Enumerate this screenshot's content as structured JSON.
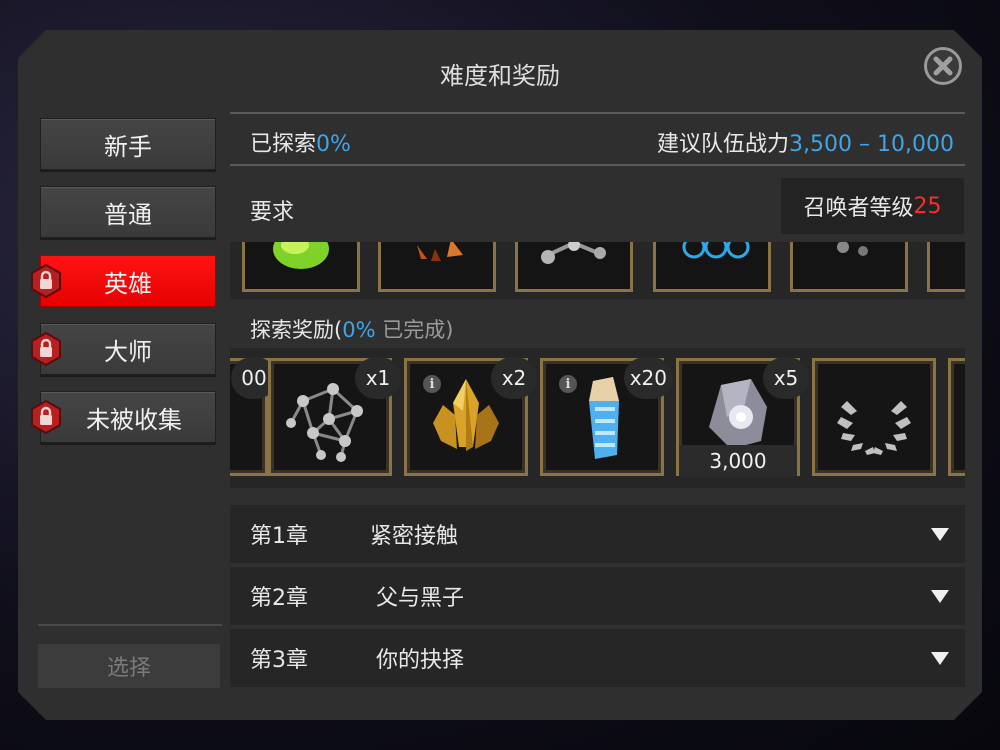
{
  "title": "难度和奖励",
  "difficulties": [
    {
      "label": "新手",
      "active": false,
      "locked": false
    },
    {
      "label": "普通",
      "active": false,
      "locked": false
    },
    {
      "label": "英雄",
      "active": true,
      "locked": true
    },
    {
      "label": "大师",
      "active": false,
      "locked": true
    },
    {
      "label": "未被收集",
      "active": false,
      "locked": true
    }
  ],
  "select_label": "选择",
  "explored": {
    "label": "已探索",
    "value": "0%"
  },
  "team_power": {
    "label": "建议队伍战力",
    "value": "3,500 – 10,000"
  },
  "requirements": {
    "label": "要求",
    "summoner_label": "召唤者等级",
    "summoner_level": "25"
  },
  "exploration_rewards": {
    "label": "探索奖励(",
    "percent": "0%",
    "suffix": " 已完成)"
  },
  "rewards": [
    {
      "partial_qty": "00"
    },
    {
      "icon": "metal-lattice-icon",
      "qty": "x1"
    },
    {
      "icon": "gold-crystal-icon",
      "qty": "x2",
      "info": true
    },
    {
      "icon": "blue-crystal-icon",
      "qty": "x20",
      "info": true
    },
    {
      "icon": "cosmic-shard-icon",
      "qty": "x5",
      "amount": "3,000"
    },
    {
      "icon": "laurel-wreath-icon"
    }
  ],
  "chapters": [
    {
      "num": "第1章",
      "name": "紧密接触"
    },
    {
      "num": "第2章",
      "name": "父与黑子"
    },
    {
      "num": "第3章",
      "name": "你的抉择"
    }
  ],
  "colors": {
    "accent_blue": "#3fa5e6",
    "active_red": "#ff0000",
    "level_red": "#ff2a2a",
    "frame_gold": "#8a7345"
  }
}
